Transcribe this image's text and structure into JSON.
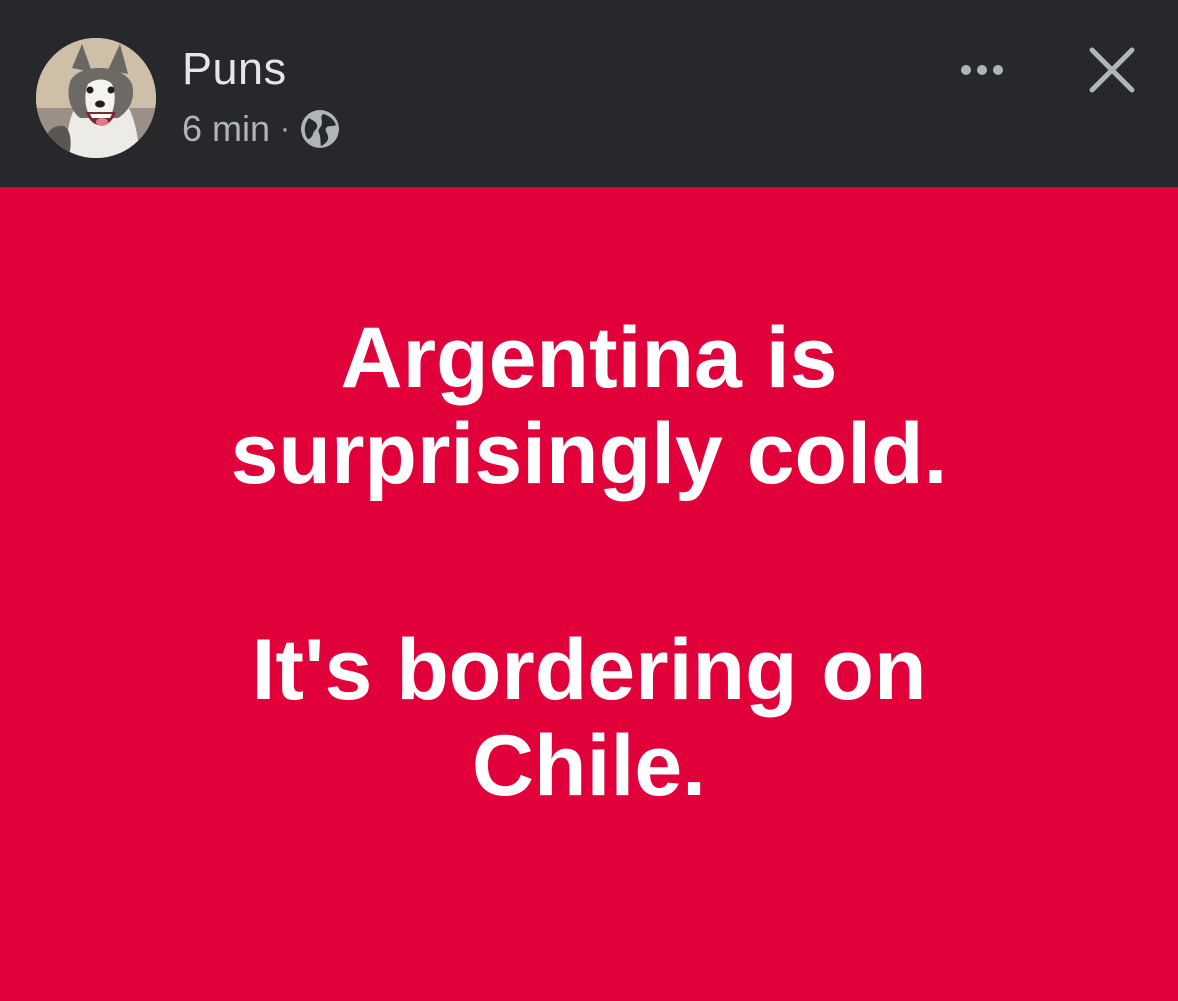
{
  "post": {
    "author": "Puns",
    "time": "6 min",
    "separator": "·",
    "audience_icon": "globe-icon",
    "text_lines": [
      "Argentina is",
      "surprisingly cold.",
      "It's bordering on",
      "Chile."
    ]
  },
  "actions": {
    "more_icon": "more-horizontal-icon",
    "close_icon": "close-icon"
  },
  "colors": {
    "header_bg": "#27282b",
    "post_bg": "#e1003a",
    "post_text": "#ffffff",
    "author_text": "#e4e6eb",
    "meta_text": "#b0b3b8"
  }
}
